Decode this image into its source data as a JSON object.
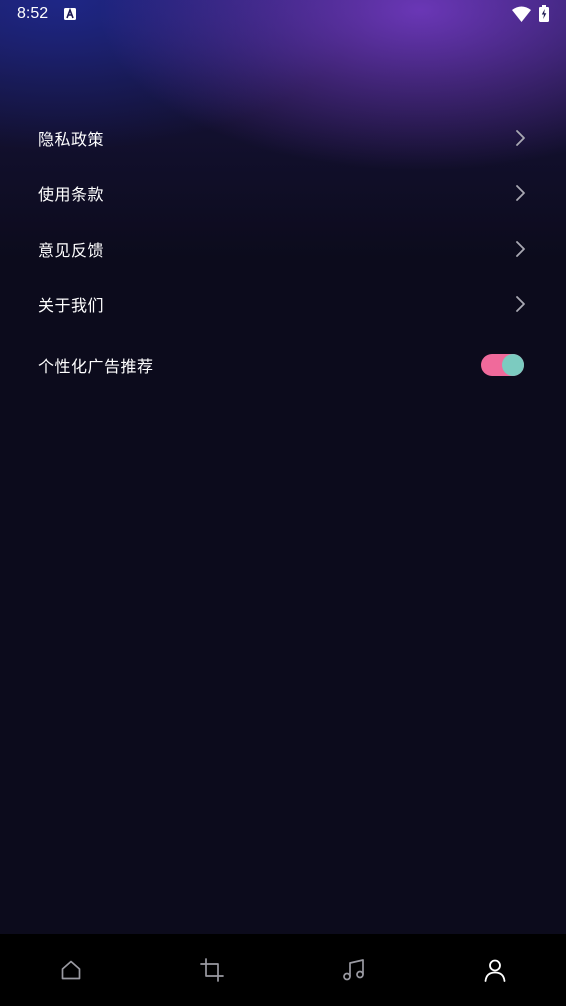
{
  "status_bar": {
    "time": "8:52",
    "notification_icon": "a-letter-icon",
    "wifi_icon": "wifi-icon",
    "battery_icon": "battery-charging-icon"
  },
  "menu": {
    "items": [
      {
        "label": "隐私政策",
        "icon": "chevron-right-icon"
      },
      {
        "label": "使用条款",
        "icon": "chevron-right-icon"
      },
      {
        "label": "意见反馈",
        "icon": "chevron-right-icon"
      },
      {
        "label": "关于我们",
        "icon": "chevron-right-icon"
      }
    ],
    "toggle": {
      "label": "个性化广告推荐",
      "on": true
    }
  },
  "bottom_nav": {
    "items": [
      {
        "icon": "home-icon",
        "active": false
      },
      {
        "icon": "crop-icon",
        "active": false
      },
      {
        "icon": "music-note-icon",
        "active": false
      },
      {
        "icon": "person-icon",
        "active": true
      }
    ]
  },
  "colors": {
    "background": "#0c0b1c",
    "text": "#ffffff",
    "chevron": "#a9a9b3",
    "toggle_track": "#f06a9b",
    "toggle_knob": "#7ccbc0",
    "nav_background": "#000000",
    "nav_icon_inactive": "#9a9aa2",
    "nav_icon_active": "#ffffff"
  }
}
